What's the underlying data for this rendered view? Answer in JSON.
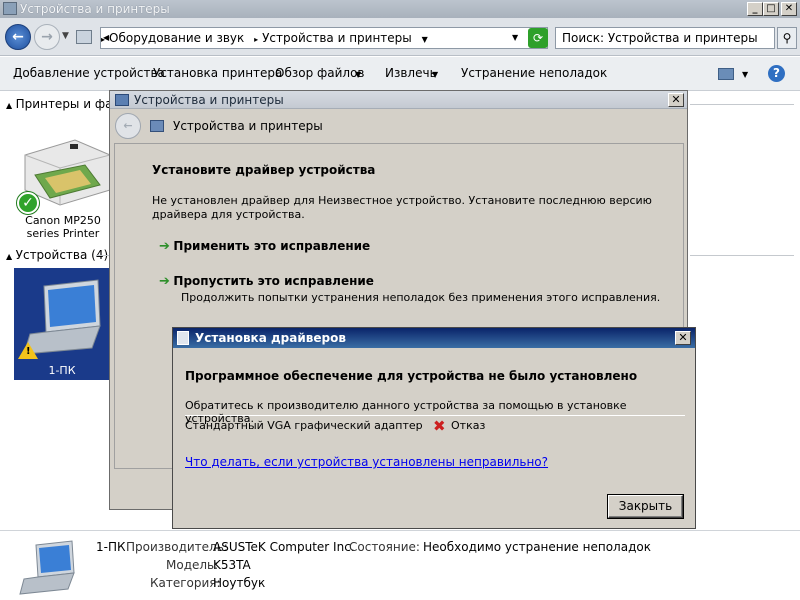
{
  "window": {
    "title": "Устройства и принтеры",
    "buttons": {
      "minimize": "_",
      "maximize": "□",
      "close": "✕"
    }
  },
  "nav": {
    "back": "←",
    "forward": "→",
    "breadcrumb": [
      "Оборудование и звук",
      "Устройства и принтеры"
    ],
    "search_placeholder": "Поиск: Устройства и принтеры"
  },
  "toolbar": {
    "items": [
      "Добавление устройства",
      "Установка принтера",
      "Обзор файлов",
      "Извлечь",
      "Устранение неполадок"
    ]
  },
  "groups": {
    "printers": {
      "label": "Принтеры и факсы",
      "devices": [
        {
          "name": "Canon MP250\nseries Printer"
        }
      ]
    },
    "devices": {
      "label": "Устройства (4)",
      "devices": [
        {
          "name": "1-ПК"
        }
      ]
    }
  },
  "troubleshooter": {
    "title": "Устройства и принтеры",
    "header": "Устройства и принтеры",
    "heading": "Установите драйвер устройства",
    "description": "Не установлен драйвер для Неизвестное устройство. Установите последнюю версию драйвера для устройства.",
    "option1": "Применить это исправление",
    "option2_title": "Пропустить это исправление",
    "option2_desc": "Продолжить попытки устранения неполадок без применения этого исправления."
  },
  "driver_dialog": {
    "title": "Установка драйверов",
    "heading": "Программное обеспечение для устройства не было установлено",
    "message": "Обратитесь к производителю данного устройства за помощью в установке устройства.",
    "device": "Стандартный VGA графический адаптер",
    "status": "Отказ",
    "help_link": "Что делать, если устройства установлены неправильно?",
    "close_button": "Закрыть"
  },
  "details": {
    "device_name": "1-ПК",
    "manufacturer_label": "Производитель:",
    "manufacturer_value": "ASUSTeK Computer Inc.",
    "model_label": "Модель:",
    "model_value": "K53TA",
    "category_label": "Категория:",
    "category_value": "Ноутбук",
    "status_label": "Состояние:",
    "status_value": "Необходимо устранение неполадок"
  },
  "colors": {
    "accent_title": "#0a246a",
    "link": "#0000ee",
    "error_icon": "#cc1f1f",
    "arrow_green": "#2d8f2a"
  }
}
